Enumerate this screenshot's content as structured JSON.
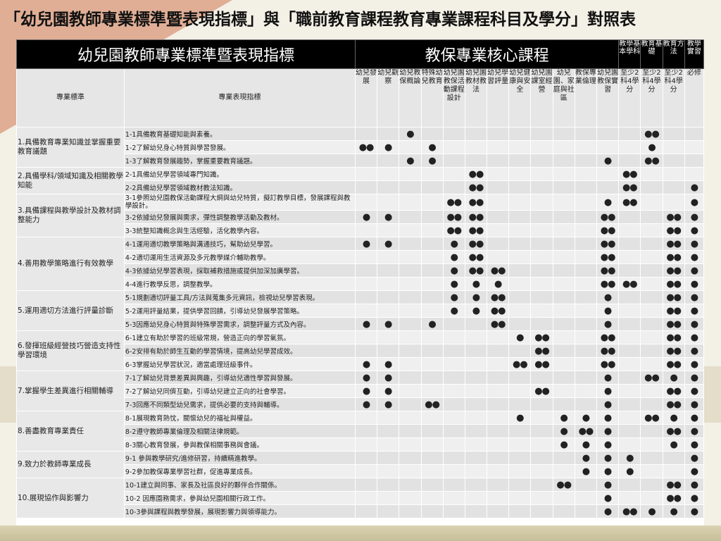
{
  "title": "「幼兒園教師專業標準暨表現指標」與「職前教育課程教育專業課程科目及學分」對照表",
  "table": {
    "header": {
      "left_group": "幼兒園教師專業標準暨表現指標",
      "core_group": "教保專業核心課程",
      "standard_col": "專業標準",
      "indicator_col": "專業表現指標"
    },
    "columns": [
      {
        "top": "",
        "label": "幼兒發展"
      },
      {
        "top": "",
        "label": "幼兒觀察"
      },
      {
        "top": "",
        "label": "幼兒教保概論"
      },
      {
        "top": "",
        "label": "特殊幼兒教育"
      },
      {
        "top": "",
        "label": "幼兒園教保活動課程設計"
      },
      {
        "top": "",
        "label": "幼兒園教材教法"
      },
      {
        "top": "",
        "label": "幼兒學習評量"
      },
      {
        "top": "",
        "label": "幼兒健康與安全"
      },
      {
        "top": "",
        "label": "幼兒園課室經營"
      },
      {
        "top": "",
        "label": "幼兒園、家庭與社區"
      },
      {
        "top": "",
        "label": "教保專業倫理"
      },
      {
        "top": "",
        "label": "幼兒園教保實習"
      },
      {
        "top": "教學基本學科",
        "label": "至少2科4學分"
      },
      {
        "top": "教育基礎",
        "label": "至少2科4學分"
      },
      {
        "top": "教育方法",
        "label": "至少2科4學分"
      },
      {
        "top": "教學實習",
        "label": "必修"
      }
    ],
    "standards": [
      {
        "label": "1.具備教育專業知識並掌握重要教育議題",
        "span": 3
      },
      {
        "label": "2.具備學科/領域知識及相關教學知能",
        "span": 2
      },
      {
        "label": "3.具備課程與教學設計及教材調整能力",
        "span": 3
      },
      {
        "label": "4.善用教學策略進行有效教學",
        "span": 4
      },
      {
        "label": "5.運用適切方法進行評量診斷",
        "span": 3
      },
      {
        "label": "6.發揮班級經營技巧營造支持性學習環境",
        "span": 3
      },
      {
        "label": "7.掌握學生差異進行相關輔導",
        "span": 3
      },
      {
        "label": "8.善盡教育專業責任",
        "span": 3
      },
      {
        "label": "9.致力於教師專業成長",
        "span": 2
      },
      {
        "label": "10.展現協作與影響力",
        "span": 3
      }
    ],
    "rows": [
      {
        "indicator": "1-1具備教育基礎知能與素養。",
        "marks": [
          "",
          "",
          "●",
          "",
          "",
          "",
          "",
          "",
          "",
          "",
          "",
          "",
          "",
          "●●",
          "",
          ""
        ]
      },
      {
        "indicator": "1-2了解幼兒身心特質與學習發展。",
        "marks": [
          "●●",
          "●",
          "",
          "●",
          "",
          "",
          "",
          "",
          "",
          "",
          "",
          "",
          "",
          "●",
          "",
          ""
        ]
      },
      {
        "indicator": "1-3了解教育發展趨勢，掌握重要教育議題。",
        "marks": [
          "",
          "",
          "●",
          "●",
          "",
          "",
          "",
          "",
          "",
          "",
          "",
          "●",
          "",
          "●●",
          "",
          ""
        ]
      },
      {
        "indicator": "2-1具備幼兒學習領域專門知識。",
        "marks": [
          "",
          "",
          "",
          "",
          "",
          "●●",
          "",
          "",
          "",
          "",
          "",
          "",
          "●●",
          "",
          "",
          ""
        ]
      },
      {
        "indicator": "2-2具備幼兒學習領域教材教法知識。",
        "marks": [
          "",
          "",
          "",
          "",
          "",
          "●●",
          "",
          "",
          "",
          "",
          "",
          "",
          "●●",
          "",
          "",
          "●"
        ]
      },
      {
        "indicator": "3-1參照幼兒園教保活動課程大綱與幼兒特質，擬訂教學目標，發展課程與教學設計。",
        "marks": [
          "",
          "",
          "",
          "",
          "●●",
          "●●",
          "",
          "",
          "",
          "",
          "",
          "●",
          "●●",
          "",
          "",
          "●"
        ]
      },
      {
        "indicator": "3-2依據幼兒發展與需求，彈性調整教學活動及教材。",
        "marks": [
          "●",
          "●",
          "",
          "",
          "●●",
          "●●",
          "",
          "",
          "",
          "",
          "",
          "●●",
          "",
          "",
          "●●",
          "●"
        ]
      },
      {
        "indicator": "3-3統整知識概念與生活經驗，活化教學內容。",
        "marks": [
          "",
          "",
          "",
          "",
          "●●",
          "●●",
          "",
          "",
          "",
          "",
          "",
          "●●",
          "",
          "",
          "●●",
          "●"
        ]
      },
      {
        "indicator": "4-1運用適切教學策略與溝通技巧，幫助幼兒學習。",
        "marks": [
          "●",
          "●",
          "",
          "",
          "●",
          "●●",
          "",
          "",
          "",
          "",
          "",
          "●●",
          "",
          "",
          "●●",
          "●"
        ]
      },
      {
        "indicator": "4-2適切運用生活資源及多元教學媒介輔助教學。",
        "marks": [
          "",
          "",
          "",
          "",
          "●",
          "●●",
          "",
          "",
          "",
          "",
          "",
          "●●",
          "",
          "",
          "●●",
          "●"
        ]
      },
      {
        "indicator": "4-3依據幼兒學習表現，採取補救措施或提供加深加廣學習。",
        "marks": [
          "",
          "",
          "",
          "",
          "●",
          "●●",
          "●●",
          "",
          "",
          "",
          "",
          "●●",
          "",
          "",
          "●●",
          "●"
        ]
      },
      {
        "indicator": "4-4進行教學反思，調整教學。",
        "marks": [
          "",
          "",
          "",
          "",
          "●",
          "●",
          "●",
          "",
          "",
          "",
          "",
          "●●",
          "●●",
          "",
          "●●",
          "●"
        ]
      },
      {
        "indicator": "5-1規劃適切評量工具/方法與蒐集多元資訊，檢視幼兒學習表現。",
        "marks": [
          "",
          "",
          "",
          "",
          "●",
          "●",
          "●●",
          "",
          "",
          "",
          "",
          "●",
          "",
          "",
          "●●",
          "●"
        ]
      },
      {
        "indicator": "5-2運用評量結果，提供學習回饋，引導幼兒發展學習策略。",
        "marks": [
          "",
          "",
          "",
          "",
          "●",
          "●",
          "●●",
          "",
          "",
          "",
          "",
          "●",
          "",
          "",
          "●●",
          "●"
        ]
      },
      {
        "indicator": "5-3因應幼兒身心特質與特殊學習需求，調整評量方式及內容。",
        "marks": [
          "●",
          "●",
          "",
          "●",
          "",
          "",
          "●●",
          "",
          "",
          "",
          "",
          "●",
          "",
          "",
          "●●",
          "●"
        ]
      },
      {
        "indicator": "6-1建立有助於學習的班級常規，營造正向的學習氣氛。",
        "marks": [
          "",
          "",
          "",
          "",
          "",
          "",
          "",
          "●",
          "●●",
          "",
          "",
          "●●",
          "",
          "",
          "●●",
          "●"
        ]
      },
      {
        "indicator": "6-2安排有助於師生互動的學習情境，提高幼兒學習成效。",
        "marks": [
          "",
          "",
          "",
          "",
          "",
          "",
          "",
          "",
          "●●",
          "",
          "",
          "●●",
          "",
          "",
          "●●",
          "●"
        ]
      },
      {
        "indicator": "6-3掌握幼兒學習狀況，適當處理班級事件。",
        "marks": [
          "●",
          "●",
          "",
          "",
          "",
          "",
          "",
          "●●",
          "●●",
          "",
          "",
          "●●",
          "",
          "",
          "●●",
          "●"
        ]
      },
      {
        "indicator": "7-1了解幼兒背景差異與興趣，引導幼兒適性學習與發展。",
        "marks": [
          "●",
          "●",
          "",
          "",
          "",
          "",
          "",
          "",
          "",
          "",
          "",
          "●",
          "",
          "●●",
          "●",
          "●"
        ]
      },
      {
        "indicator": "7-2了解幼兒同儕互動，引導幼兒建立正向的社會學習。",
        "marks": [
          "●",
          "●",
          "",
          "",
          "",
          "",
          "",
          "",
          "●●",
          "",
          "",
          "●",
          "",
          "",
          "●●",
          "●"
        ]
      },
      {
        "indicator": "7-3回應不同類型幼兒需求，提供必要的支持與輔導。",
        "marks": [
          "●",
          "●",
          "",
          "●●",
          "",
          "",
          "",
          "",
          "",
          "",
          "",
          "●",
          "",
          "",
          "●●",
          "●"
        ]
      },
      {
        "indicator": "8-1展現教育熱忱，關懷幼兒的福祉與權益。",
        "marks": [
          "",
          "",
          "",
          "",
          "",
          "",
          "",
          "●",
          "",
          "●",
          "●",
          "●",
          "",
          "●●",
          "●",
          "●"
        ]
      },
      {
        "indicator": "8-2遵守教師專業倫理及相關法律規範。",
        "marks": [
          "",
          "",
          "",
          "",
          "",
          "",
          "",
          "",
          "",
          "●",
          "●●",
          "●",
          "",
          "",
          "●●",
          "●"
        ]
      },
      {
        "indicator": "8-3關心教育發展，參與教保相關事務與會議。",
        "marks": [
          "",
          "",
          "",
          "",
          "",
          "",
          "",
          "",
          "",
          "●",
          "●",
          "●",
          "",
          "",
          "●",
          "●"
        ]
      },
      {
        "indicator": "9-1 參與教學研究/進修研習，持續精進教學。",
        "marks": [
          "",
          "",
          "",
          "",
          "",
          "",
          "",
          "",
          "",
          "",
          "●",
          "●",
          "●",
          "",
          "",
          "●"
        ]
      },
      {
        "indicator": "9-2參加教保專業學習社群，促進專業成長。",
        "marks": [
          "",
          "",
          "",
          "",
          "",
          "",
          "",
          "",
          "",
          "",
          "●",
          "●",
          "●",
          "",
          "",
          "●"
        ]
      },
      {
        "indicator": "10-1建立與同事、家長及社區良好的夥伴合作關係。",
        "marks": [
          "",
          "",
          "",
          "",
          "",
          "",
          "",
          "",
          "",
          "●●",
          "",
          "●",
          "",
          "",
          "●●",
          "●"
        ]
      },
      {
        "indicator": "10-2 因應園務需求，參與幼兒園相關行政工作。",
        "marks": [
          "",
          "",
          "",
          "",
          "",
          "",
          "",
          "",
          "",
          "",
          "",
          "●",
          "",
          "",
          "●●",
          "●"
        ]
      },
      {
        "indicator": "10-3參與課程與教學發展，展現影響力與領導能力。",
        "marks": [
          "",
          "",
          "",
          "",
          "",
          "",
          "",
          "",
          "",
          "",
          "",
          "●",
          "●●",
          "●",
          "●",
          "●"
        ]
      }
    ]
  }
}
